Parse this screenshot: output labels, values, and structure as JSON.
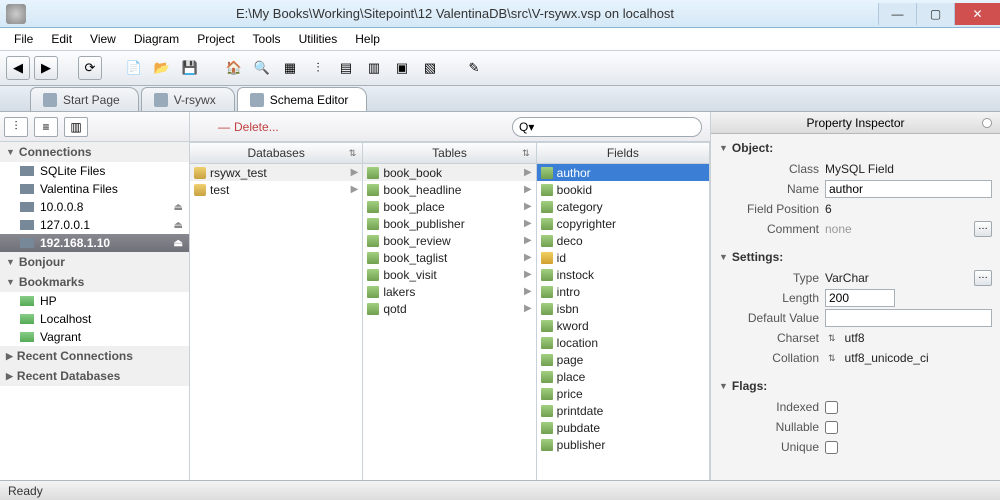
{
  "window": {
    "title": "E:\\My Books\\Working\\Sitepoint\\12 ValentinaDB\\src\\V-rsywx.vsp on localhost"
  },
  "menu": {
    "items": [
      "File",
      "Edit",
      "View",
      "Diagram",
      "Project",
      "Tools",
      "Utilities",
      "Help"
    ]
  },
  "tabs": [
    {
      "label": "Start Page",
      "active": false
    },
    {
      "label": "V-rsywx",
      "active": false
    },
    {
      "label": "Schema Editor",
      "active": true
    }
  ],
  "subtoolbar": {
    "delete": "Delete...",
    "search_placeholder": ""
  },
  "columns": {
    "databases": "Databases",
    "tables": "Tables",
    "fields": "Fields"
  },
  "databases": [
    "rsywx_test",
    "test"
  ],
  "databases_selected": 0,
  "tables": [
    "book_book",
    "book_headline",
    "book_place",
    "book_publisher",
    "book_review",
    "book_taglist",
    "book_visit",
    "lakers",
    "qotd"
  ],
  "tables_selected": 0,
  "fields": [
    "author",
    "bookid",
    "category",
    "copyrighter",
    "deco",
    "id",
    "instock",
    "intro",
    "isbn",
    "kword",
    "location",
    "page",
    "place",
    "price",
    "printdate",
    "pubdate",
    "publisher"
  ],
  "fields_selected": 0,
  "fields_key_index": 5,
  "sidebar": {
    "sections": [
      {
        "label": "Connections",
        "open": true,
        "items": [
          {
            "label": "SQLite Files",
            "icon": "folder"
          },
          {
            "label": "Valentina Files",
            "icon": "folder"
          },
          {
            "label": "10.0.0.8",
            "icon": "server",
            "eject": true
          },
          {
            "label": "127.0.0.1",
            "icon": "server",
            "eject": true
          },
          {
            "label": "192.168.1.10",
            "icon": "server",
            "eject": true,
            "selected": true
          }
        ]
      },
      {
        "label": "Bonjour",
        "open": true,
        "items": []
      },
      {
        "label": "Bookmarks",
        "open": true,
        "items": [
          {
            "label": "HP",
            "icon": "bookmark"
          },
          {
            "label": "Localhost",
            "icon": "bookmark"
          },
          {
            "label": "Vagrant",
            "icon": "bookmark"
          }
        ]
      },
      {
        "label": "Recent Connections",
        "open": false,
        "items": []
      },
      {
        "label": "Recent Databases",
        "open": false,
        "items": []
      }
    ]
  },
  "inspector": {
    "title": "Property Inspector",
    "object": {
      "header": "Object:",
      "class_label": "Class",
      "class_value": "MySQL Field",
      "name_label": "Name",
      "name_value": "author",
      "fieldpos_label": "Field Position",
      "fieldpos_value": "6",
      "comment_label": "Comment",
      "comment_value": "none"
    },
    "settings": {
      "header": "Settings:",
      "type_label": "Type",
      "type_value": "VarChar",
      "length_label": "Length",
      "length_value": "200",
      "default_label": "Default Value",
      "default_value": "",
      "charset_label": "Charset",
      "charset_value": "utf8",
      "collation_label": "Collation",
      "collation_value": "utf8_unicode_ci"
    },
    "flags": {
      "header": "Flags:",
      "indexed_label": "Indexed",
      "nullable_label": "Nullable",
      "unique_label": "Unique"
    }
  },
  "status": {
    "text": "Ready"
  }
}
